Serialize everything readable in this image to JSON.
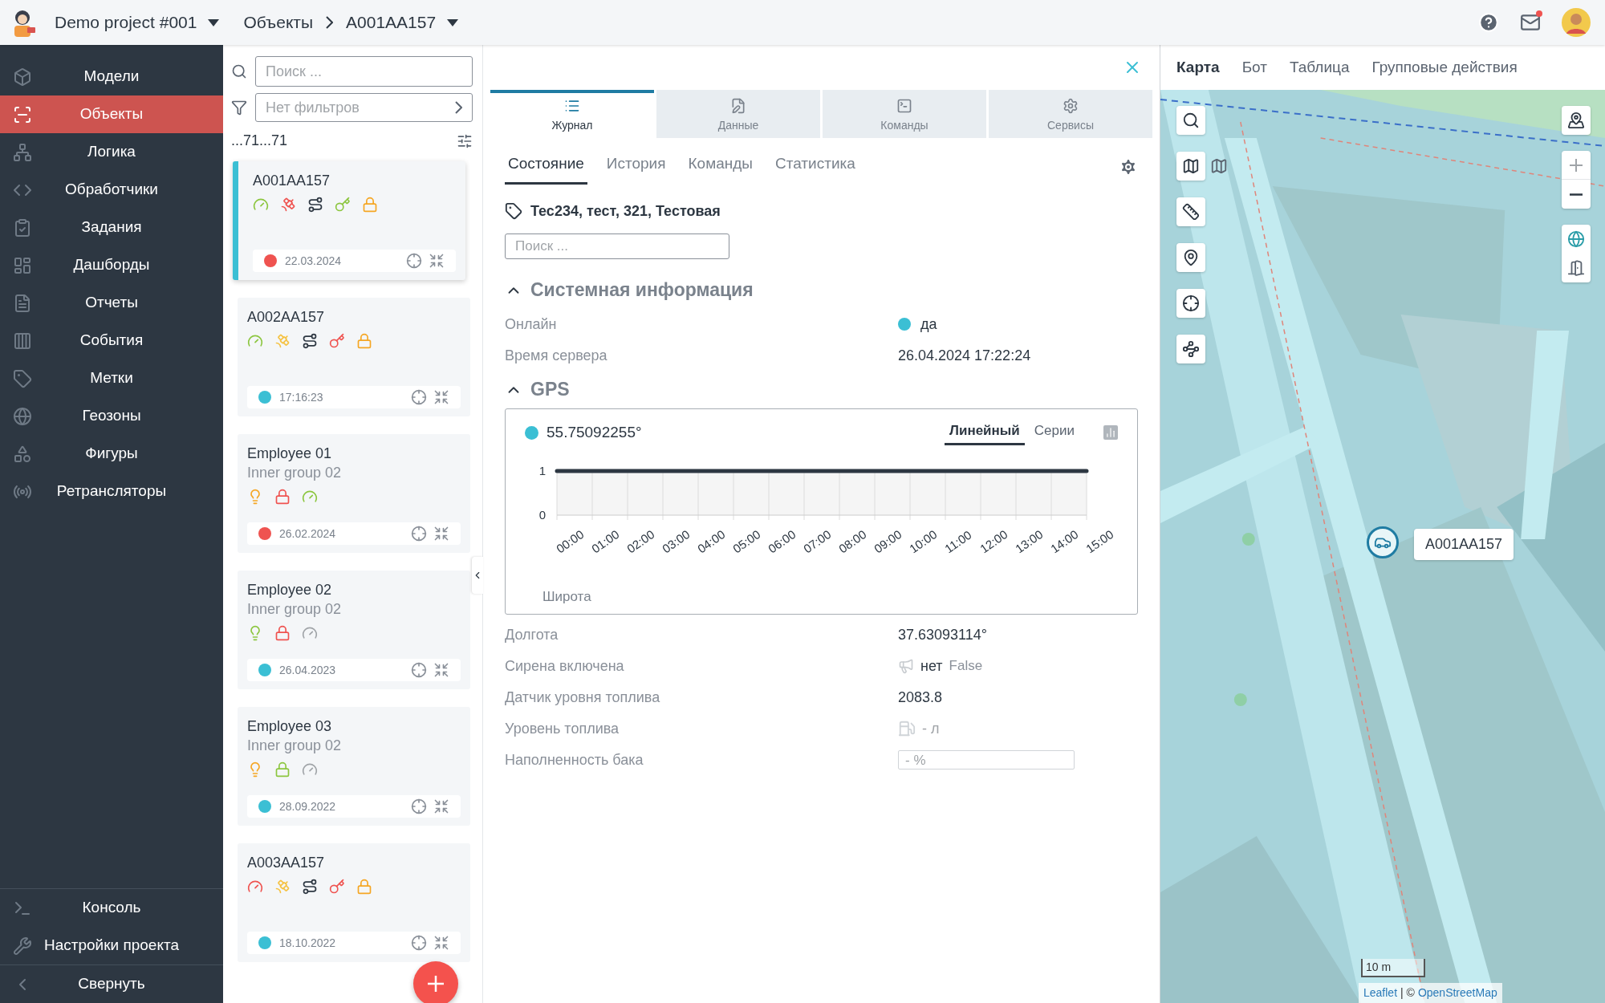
{
  "header": {
    "project": "Demo project #001",
    "breadcrumb": "Объекты",
    "current": "A001AA157",
    "mail_unread": true
  },
  "sidebar": {
    "items": [
      {
        "label": "Модели",
        "kind": "models",
        "selected": false
      },
      {
        "label": "Объекты",
        "kind": "objects",
        "selected": true
      },
      {
        "label": "Логика",
        "kind": "logic",
        "selected": false
      },
      {
        "label": "Обработчики",
        "kind": "handlers",
        "selected": false
      },
      {
        "label": "Задания",
        "kind": "tasks",
        "selected": false
      },
      {
        "label": "Дашборды",
        "kind": "dashboards",
        "selected": false
      },
      {
        "label": "Отчеты",
        "kind": "reports",
        "selected": false
      },
      {
        "label": "События",
        "kind": "events",
        "selected": false
      },
      {
        "label": "Метки",
        "kind": "tags",
        "selected": false
      },
      {
        "label": "Геозоны",
        "kind": "geozones",
        "selected": false
      },
      {
        "label": "Фигуры",
        "kind": "shapes",
        "selected": false
      },
      {
        "label": "Ретрансляторы",
        "kind": "relays",
        "selected": false
      }
    ],
    "bottom_items": [
      {
        "label": "Консоль",
        "kind": "console"
      },
      {
        "label": "Настройки проекта",
        "kind": "settings"
      },
      {
        "label": "Свернуть",
        "kind": "collapse"
      }
    ]
  },
  "objects": {
    "search_placeholder": "Поиск ...",
    "filter": "Нет фильтров",
    "count": "...71...71",
    "cards": [
      {
        "name": "A001AA157",
        "selected": true,
        "icons": [
          {
            "kind": "gauge",
            "color": "#8cc63f"
          },
          {
            "kind": "satellite",
            "color": "#ef5350"
          },
          {
            "kind": "route",
            "color": "#2d3742"
          },
          {
            "kind": "key",
            "color": "#8cc63f"
          },
          {
            "kind": "lock",
            "color": "#f5a623"
          }
        ],
        "color": "#ef5350",
        "date": "22.03.2024"
      },
      {
        "name": "A002AA157",
        "selected": false,
        "icons": [
          {
            "kind": "gauge",
            "color": "#8cc63f"
          },
          {
            "kind": "satellite",
            "color": "#f5c242"
          },
          {
            "kind": "route",
            "color": "#2d3742"
          },
          {
            "kind": "key",
            "color": "#ef5350"
          },
          {
            "kind": "lock",
            "color": "#f5a623"
          }
        ],
        "color": "#3bbfd4",
        "date": "17:16:23"
      },
      {
        "name": "Employee 01",
        "group": "Inner group 02",
        "selected": false,
        "icons": [
          {
            "kind": "bulb",
            "color": "#f5a623"
          },
          {
            "kind": "lock",
            "color": "#ef5350"
          },
          {
            "kind": "gauge",
            "color": "#8cc63f"
          }
        ],
        "color": "#ef5350",
        "date": "26.02.2024"
      },
      {
        "name": "Employee 02",
        "group": "Inner group 02",
        "selected": false,
        "icons": [
          {
            "kind": "bulb",
            "color": "#8cc63f"
          },
          {
            "kind": "lock",
            "color": "#ef5350"
          },
          {
            "kind": "gauge",
            "color": "#a0a4a8"
          }
        ],
        "color": "#3bbfd4",
        "date": "26.04.2023"
      },
      {
        "name": "Employee 03",
        "group": "Inner group 02",
        "selected": false,
        "icons": [
          {
            "kind": "bulb",
            "color": "#f5a623"
          },
          {
            "kind": "lock",
            "color": "#8cc63f"
          },
          {
            "kind": "gauge",
            "color": "#a0a4a8"
          }
        ],
        "color": "#3bbfd4",
        "date": "28.09.2022"
      },
      {
        "name": "A003AA157",
        "selected": false,
        "icons": [
          {
            "kind": "gauge",
            "color": "#ef5350"
          },
          {
            "kind": "satellite",
            "color": "#f5c242"
          },
          {
            "kind": "route",
            "color": "#2d3742"
          },
          {
            "kind": "key",
            "color": "#ef5350"
          },
          {
            "kind": "lock",
            "color": "#f5a623"
          }
        ],
        "color": "#3bbfd4",
        "date": "18.10.2022"
      }
    ]
  },
  "panel": {
    "tabs": [
      {
        "label": "Журнал",
        "kind": "journal",
        "selected": true
      },
      {
        "label": "Данные",
        "kind": "data",
        "selected": false
      },
      {
        "label": "Команды",
        "kind": "commands",
        "selected": false
      },
      {
        "label": "Сервисы",
        "kind": "services",
        "selected": false
      }
    ],
    "subtabs": [
      {
        "label": "Состояние",
        "selected": true
      },
      {
        "label": "История",
        "selected": false
      },
      {
        "label": "Команды",
        "selected": false
      },
      {
        "label": "Статистика",
        "selected": false
      }
    ],
    "tags": "Тес234, тест, 321, Тестовая",
    "search_placeholder": "Поиск ...",
    "sections": [
      {
        "title": "Системная информация",
        "expanded": true,
        "rows": [
          {
            "label": "Онлайн",
            "kind": "status",
            "value": "да",
            "color": "#3bbfd4"
          },
          {
            "label": "Время сервера",
            "kind": "text",
            "value": "26.04.2024 17:22:24"
          }
        ]
      },
      {
        "title": "GPS",
        "expanded": true,
        "chart": {
          "value": "55.75092255°",
          "color": "#3bbfd4",
          "modes": [
            {
              "label": "Линейный",
              "selected": true
            },
            {
              "label": "Серии",
              "selected": false
            }
          ],
          "chart_data": {
            "type": "line",
            "xlabel": "Широта",
            "categories": [
              "00:00",
              "01:00",
              "02:00",
              "03:00",
              "04:00",
              "05:00",
              "06:00",
              "07:00",
              "08:00",
              "09:00",
              "10:00",
              "11:00",
              "12:00",
              "13:00",
              "14:00",
              "15:00"
            ],
            "ylim": [
              0,
              1
            ],
            "yticks": [
              0,
              1
            ],
            "series": [
              {
                "color": "#2d3742",
                "values": [
                  1,
                  1,
                  1,
                  1,
                  1,
                  1,
                  1,
                  1,
                  1,
                  1,
                  1,
                  1,
                  1,
                  1,
                  1,
                  1
                ]
              }
            ]
          }
        },
        "rows": [
          {
            "label": "Долгота",
            "kind": "text",
            "value": "37.63093114°"
          },
          {
            "label": "Сирена включена",
            "kind": "siren",
            "value": "нет",
            "note": "False"
          },
          {
            "label": "Датчик уровня топлива",
            "kind": "text",
            "value": "2083.8"
          },
          {
            "label": "Уровень топлива",
            "kind": "fuel",
            "value": "- л"
          },
          {
            "label": "Наполненность бака",
            "kind": "tank",
            "placeholder": "- %"
          }
        ]
      }
    ]
  },
  "map": {
    "tabs": [
      {
        "label": "Карта",
        "selected": true
      },
      {
        "label": "Бот",
        "selected": false
      },
      {
        "label": "Таблица",
        "selected": false
      },
      {
        "label": "Групповые действия",
        "selected": false
      }
    ],
    "marker_label": "A001AA157",
    "scale": "10 m",
    "attribution": {
      "leaflet": "Leaflet",
      "separator": "| ©",
      "osm": "OpenStreetMap"
    }
  }
}
